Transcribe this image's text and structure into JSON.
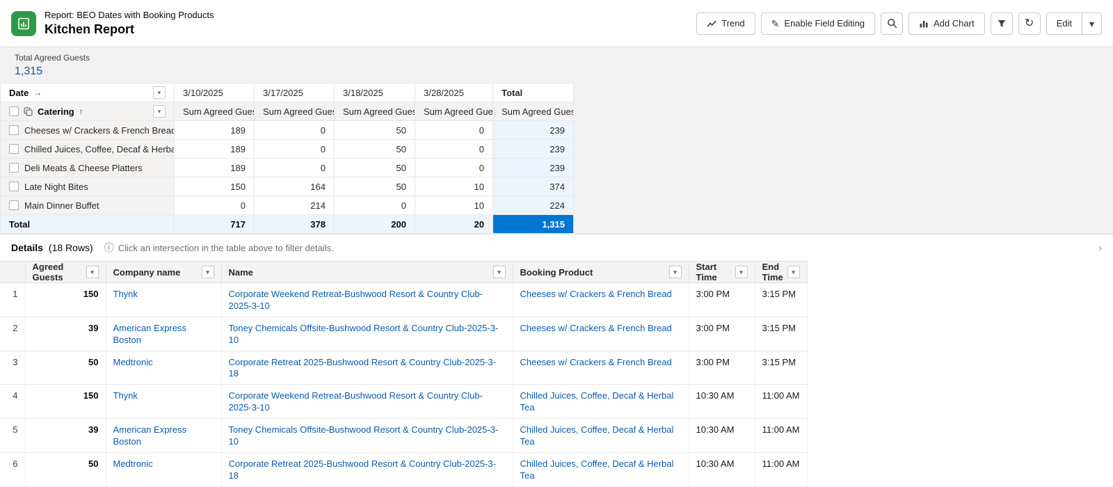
{
  "icons": {
    "dropdown": "▾",
    "arrow_right": "→",
    "arrow_up": "↑",
    "pencil": "✎",
    "refresh": "↻",
    "info": "ⓘ",
    "chevron_right": "›",
    "chevron_down": "▾"
  },
  "colors": {
    "brand_green": "#2e9a47",
    "link_blue": "#0b5cab",
    "selected_cell_blue": "#0176d3",
    "total_tint_blue": "#eef4fb"
  },
  "header": {
    "report_type": "Report: BEO Dates with Booking Products",
    "title": "Kitchen Report",
    "actions": {
      "trend": "Trend",
      "enable_field_editing": "Enable Field Editing",
      "add_chart": "Add Chart",
      "edit": "Edit"
    }
  },
  "summary": {
    "label": "Total Agreed Guests",
    "value": "1,315"
  },
  "pivot": {
    "col_dimension": "Date",
    "row_dimension": "Catering",
    "measure": "Sum Agreed Guests",
    "total_label": "Total",
    "columns": [
      "3/10/2025",
      "3/17/2025",
      "3/18/2025",
      "3/28/2025"
    ],
    "rows": [
      {
        "label": "Cheeses w/ Crackers & French Bread",
        "v0": "189",
        "v1": "0",
        "v2": "50",
        "v3": "0",
        "total": "239"
      },
      {
        "label": "Chilled Juices, Coffee, Decaf & Herbal Tea",
        "v0": "189",
        "v1": "0",
        "v2": "50",
        "v3": "0",
        "total": "239"
      },
      {
        "label": "Deli Meats & Cheese Platters",
        "v0": "189",
        "v1": "0",
        "v2": "50",
        "v3": "0",
        "total": "239"
      },
      {
        "label": "Late Night Bites",
        "v0": "150",
        "v1": "164",
        "v2": "50",
        "v3": "10",
        "total": "374"
      },
      {
        "label": "Main Dinner Buffet",
        "v0": "0",
        "v1": "214",
        "v2": "0",
        "v3": "10",
        "total": "224"
      }
    ],
    "totals": {
      "label": "Total",
      "v0": "717",
      "v1": "378",
      "v2": "200",
      "v3": "20",
      "grand": "1,315"
    }
  },
  "details": {
    "title": "Details",
    "row_count": "(18 Rows)",
    "hint": "Click an intersection in the table above to filter details.",
    "columns": {
      "agreed_guests": "Agreed Guests",
      "company": "Company name",
      "name": "Name",
      "product": "Booking Product",
      "start": "Start Time",
      "end": "End Time"
    },
    "rows": [
      {
        "num": "1",
        "guests": "150",
        "company": "Thynk",
        "name": "Corporate Weekend Retreat-Bushwood Resort & Country Club-2025-3-10",
        "product": "Cheeses w/ Crackers & French Bread",
        "start": "3:00 PM",
        "end": "3:15 PM"
      },
      {
        "num": "2",
        "guests": "39",
        "company": "American Express Boston",
        "name": "Toney Chemicals Offsite-Bushwood Resort & Country Club-2025-3-10",
        "product": "Cheeses w/ Crackers & French Bread",
        "start": "3:00 PM",
        "end": "3:15 PM"
      },
      {
        "num": "3",
        "guests": "50",
        "company": "Medtronic",
        "name": "Corporate Retreat 2025-Bushwood Resort & Country Club-2025-3-18",
        "product": "Cheeses w/ Crackers & French Bread",
        "start": "3:00 PM",
        "end": "3:15 PM"
      },
      {
        "num": "4",
        "guests": "150",
        "company": "Thynk",
        "name": "Corporate Weekend Retreat-Bushwood Resort & Country Club-2025-3-10",
        "product": "Chilled Juices, Coffee, Decaf & Herbal Tea",
        "start": "10:30 AM",
        "end": "11:00 AM"
      },
      {
        "num": "5",
        "guests": "39",
        "company": "American Express Boston",
        "name": "Toney Chemicals Offsite-Bushwood Resort & Country Club-2025-3-10",
        "product": "Chilled Juices, Coffee, Decaf & Herbal Tea",
        "start": "10:30 AM",
        "end": "11:00 AM"
      },
      {
        "num": "6",
        "guests": "50",
        "company": "Medtronic",
        "name": "Corporate Retreat 2025-Bushwood Resort & Country Club-2025-3-18",
        "product": "Chilled Juices, Coffee, Decaf & Herbal Tea",
        "start": "10:30 AM",
        "end": "11:00 AM"
      }
    ]
  }
}
